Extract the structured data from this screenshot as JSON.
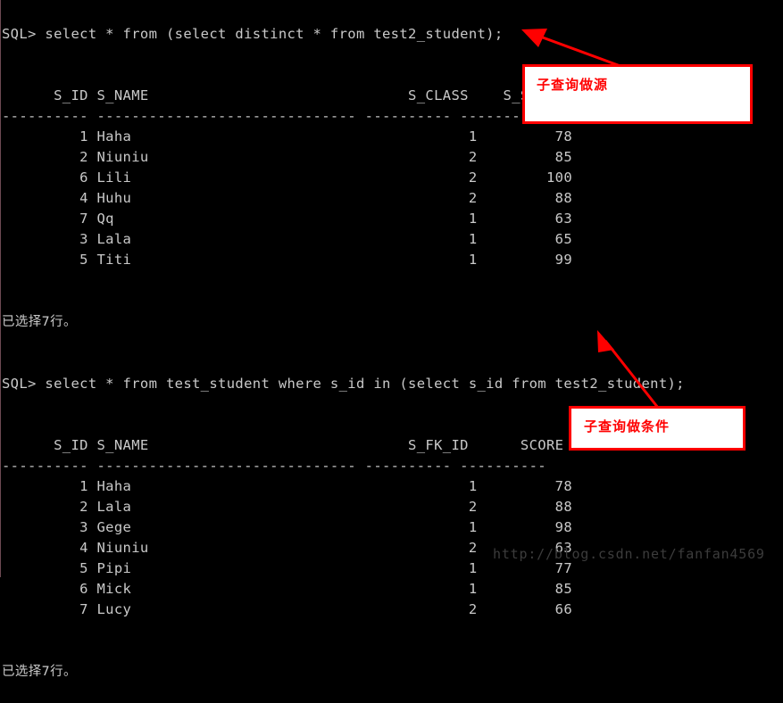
{
  "terminal": {
    "prompt": "SQL> ",
    "background_color": "#000000",
    "text_color": "#c9c9c9",
    "blocks": [
      {
        "command": "SQL> select * from (select distinct * from test2_student);",
        "header": "      S_ID S_NAME                              S_CLASS    S_SCORE",
        "separator": "---------- ------------------------------ ---------- ----------",
        "rows": [
          "         1 Haha                                       1         78",
          "         2 Niuniu                                     2         85",
          "         6 Lili                                       2        100",
          "         4 Huhu                                       2         88",
          "         7 Qq                                         1         63",
          "         3 Lala                                       1         65",
          "         5 Titi                                       1         99"
        ],
        "footer": "已选择7行。"
      },
      {
        "command": "SQL> select * from test_student where s_id in (select s_id from test2_student);",
        "header": "      S_ID S_NAME                              S_FK_ID      SCORE",
        "separator": "---------- ------------------------------ ---------- ----------",
        "rows": [
          "         1 Haha                                       1         78",
          "         2 Lala                                       2         88",
          "         3 Gege                                       1         98",
          "         4 Niuniu                                     2         63",
          "         5 Pipi                                       1         77",
          "         6 Mick                                       1         85",
          "         7 Lucy                                       2         66"
        ],
        "footer": "已选择7行。"
      }
    ]
  },
  "table_data": [
    {
      "query": "select * from (select distinct * from test2_student);",
      "columns": [
        "S_ID",
        "S_NAME",
        "S_CLASS",
        "S_SCORE"
      ],
      "rows": [
        [
          1,
          "Haha",
          1,
          78
        ],
        [
          2,
          "Niuniu",
          2,
          85
        ],
        [
          6,
          "Lili",
          2,
          100
        ],
        [
          4,
          "Huhu",
          2,
          88
        ],
        [
          7,
          "Qq",
          1,
          63
        ],
        [
          3,
          "Lala",
          1,
          65
        ],
        [
          5,
          "Titi",
          1,
          99
        ]
      ],
      "row_count_message": "已选择7行。"
    },
    {
      "query": "select * from test_student where s_id in (select s_id from test2_student);",
      "columns": [
        "S_ID",
        "S_NAME",
        "S_FK_ID",
        "SCORE"
      ],
      "rows": [
        [
          1,
          "Haha",
          1,
          78
        ],
        [
          2,
          "Lala",
          2,
          88
        ],
        [
          3,
          "Gege",
          1,
          98
        ],
        [
          4,
          "Niuniu",
          2,
          63
        ],
        [
          5,
          "Pipi",
          1,
          77
        ],
        [
          6,
          "Mick",
          1,
          85
        ],
        [
          7,
          "Lucy",
          2,
          66
        ]
      ],
      "row_count_message": "已选择7行。"
    }
  ],
  "annotations": [
    {
      "id": "callout-1",
      "text": "子查询做源",
      "border_color": "#ff0000",
      "fill_color": "#ffffff",
      "text_color": "#ff0000"
    },
    {
      "id": "callout-2",
      "text": "子查询做条件",
      "border_color": "#ff0000",
      "fill_color": "#ffffff",
      "text_color": "#ff0000"
    }
  ],
  "watermark": {
    "text": "http://blog.csdn.net/fanfan4569",
    "color": "#3c3c3c"
  }
}
